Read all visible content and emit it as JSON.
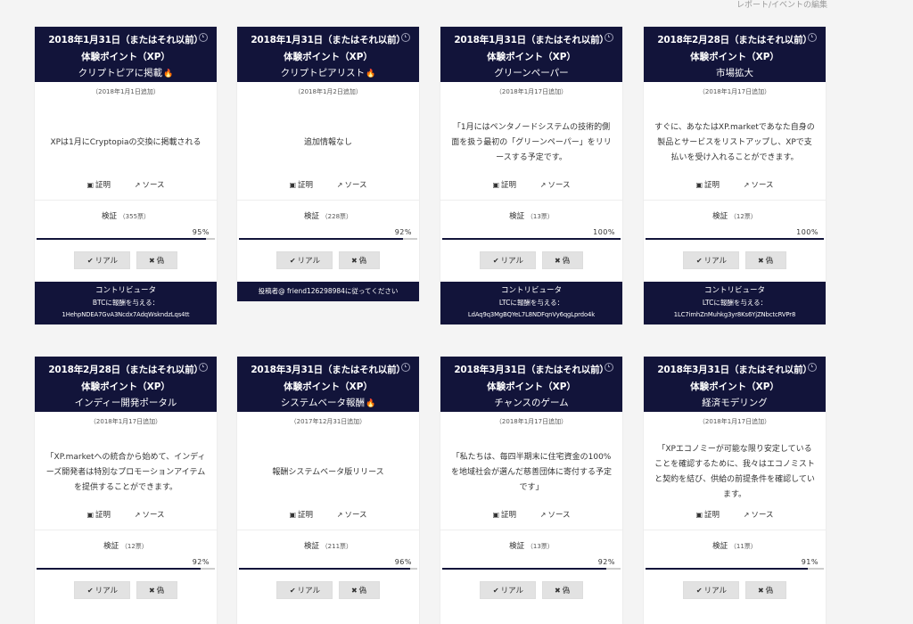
{
  "page": {
    "edit_link": "レポート/イベントの編集"
  },
  "cards": [
    {
      "date": "2018年1月31日（またはそれ以前）",
      "coin": "体験ポイント（XP）",
      "title": "クリプトピアに掲載",
      "hot": true,
      "added": "（2018年1月1日追加）",
      "description": "XPは1月にCryptopiaの交換に掲載される",
      "proof_label": "証明",
      "source_label": "ソース",
      "vote_label": "検証",
      "vote_count": "（355票）",
      "percent_text": "95%",
      "percent": 95,
      "real_label": "リアル",
      "fake_label": "偽",
      "footer_title": "コントリビュータ",
      "footer_sub": "BTCに報酬を与える：",
      "footer_addr": "1HehpNDEA7GvA3Ncdx7AdqWskndzLqs4tt"
    },
    {
      "date": "2018年1月31日（またはそれ以前）",
      "coin": "体験ポイント（XP）",
      "title": "クリプトピアリスト",
      "hot": true,
      "added": "（2018年1月2日追加）",
      "description": "追加情報なし",
      "proof_label": "証明",
      "source_label": "ソース",
      "vote_label": "検証",
      "vote_count": "（228票）",
      "percent_text": "92%",
      "percent": 92,
      "real_label": "リアル",
      "fake_label": "偽",
      "footer_single": "投稿者@ friend126298984に従ってください"
    },
    {
      "date": "2018年1月31日（またはそれ以前）",
      "coin": "体験ポイント（XP）",
      "title": "グリーンペーパー",
      "hot": false,
      "added": "（2018年1月17日追加）",
      "description": "「1月にはペンタノードシステムの技術的側面を扱う最初の「グリーンペーパー」をリリースする予定です。",
      "proof_label": "証明",
      "source_label": "ソース",
      "vote_label": "検証",
      "vote_count": "（13票）",
      "percent_text": "100%",
      "percent": 100,
      "real_label": "リアル",
      "fake_label": "偽",
      "footer_title": "コントリビュータ",
      "footer_sub": "LTCに報酬を与える：",
      "footer_addr": "LdAq9q3MgBQYeL7L8NDFqnVy6qgLprdo4k"
    },
    {
      "date": "2018年2月28日（またはそれ以前）",
      "coin": "体験ポイント（XP）",
      "title": "市場拡大",
      "hot": false,
      "added": "（2018年1月17日追加）",
      "description": "すぐに、あなたはXP.marketであなた自身の製品とサービスをリストアップし、XPで支払いを受け入れることができます。",
      "proof_label": "証明",
      "source_label": "ソース",
      "vote_label": "検証",
      "vote_count": "（12票）",
      "percent_text": "100%",
      "percent": 100,
      "real_label": "リアル",
      "fake_label": "偽",
      "footer_title": "コントリビュータ",
      "footer_sub": "LTCに報酬を与える：",
      "footer_addr": "1LC7imhZnMuhkg3yr8Ks6YjZNbctcRVPr8"
    },
    {
      "date": "2018年2月28日（またはそれ以前）",
      "coin": "体験ポイント（XP）",
      "title": "インディー開発ポータル",
      "hot": false,
      "added": "（2018年1月17日追加）",
      "description": "「XP.marketへの統合から始めて、インディーズ開発者は特別なプロモーションアイテムを提供することができます。",
      "proof_label": "証明",
      "source_label": "ソース",
      "vote_label": "検証",
      "vote_count": "（12票）",
      "percent_text": "92%",
      "percent": 92,
      "real_label": "リアル",
      "fake_label": "偽"
    },
    {
      "date": "2018年3月31日（またはそれ以前）",
      "coin": "体験ポイント（XP）",
      "title": "システムベータ報酬",
      "hot": true,
      "added": "（2017年12月31日追加）",
      "description": "報酬システムベータ版リリース",
      "proof_label": "証明",
      "source_label": "ソース",
      "vote_label": "検証",
      "vote_count": "（211票）",
      "percent_text": "96%",
      "percent": 96,
      "real_label": "リアル",
      "fake_label": "偽"
    },
    {
      "date": "2018年3月31日（またはそれ以前）",
      "coin": "体験ポイント（XP）",
      "title": "チャンスのゲーム",
      "hot": false,
      "added": "（2018年1月17日追加）",
      "description": "「私たちは、毎四半期末に住宅資金の100%を地域社会が選んだ慈善団体に寄付する予定です」",
      "proof_label": "証明",
      "source_label": "ソース",
      "vote_label": "検証",
      "vote_count": "（13票）",
      "percent_text": "92%",
      "percent": 92,
      "real_label": "リアル",
      "fake_label": "偽"
    },
    {
      "date": "2018年3月31日（またはそれ以前）",
      "coin": "体験ポイント（XP）",
      "title": "経済モデリング",
      "hot": false,
      "added": "（2018年1月17日追加）",
      "description": "「XPエコノミーが可能な限り安定していることを確認するために、我々はエコノミストと契約を結び、供給の前提条件を確認しています。",
      "proof_label": "証明",
      "source_label": "ソース",
      "vote_label": "検証",
      "vote_count": "（11票）",
      "percent_text": "91%",
      "percent": 91,
      "real_label": "リアル",
      "fake_label": "偽"
    }
  ]
}
